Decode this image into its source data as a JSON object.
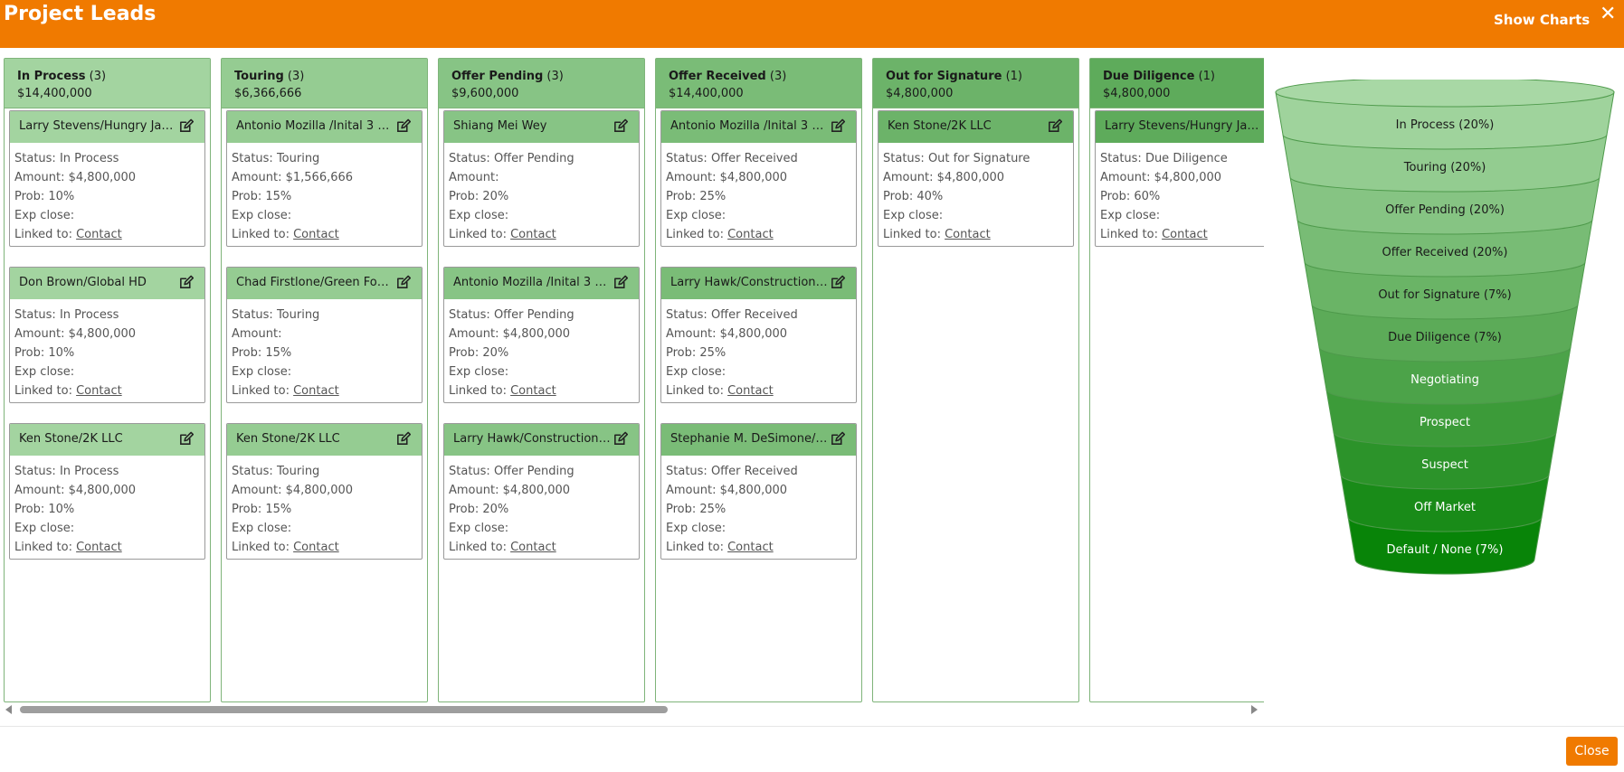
{
  "header": {
    "title": "Project Leads",
    "show_charts": "Show Charts",
    "close_glyph": "✕"
  },
  "labels": {
    "status": "Status: ",
    "amount": "Amount: ",
    "prob": "Prob: ",
    "exp_close": "Exp close: ",
    "linked_to": "Linked to: "
  },
  "colors": {
    "accent": "#f07a00"
  },
  "columns": [
    {
      "name": "In Process",
      "count": "(3)",
      "total": "$14,400,000",
      "head_color": "#a3d4a0",
      "cards": [
        {
          "title": "Larry Stevens/Hungry Jacks",
          "status": "In Process",
          "amount": "$4,800,000",
          "prob": "10%",
          "exp_close": "",
          "linked": "Contact"
        },
        {
          "title": "Don Brown/Global HD",
          "status": "In Process",
          "amount": "$4,800,000",
          "prob": "10%",
          "exp_close": "",
          "linked": "Contact"
        },
        {
          "title": "Ken Stone/2K LLC",
          "status": "In Process",
          "amount": "$4,800,000",
          "prob": "10%",
          "exp_close": "",
          "linked": "Contact"
        }
      ]
    },
    {
      "name": "Touring",
      "count": "(3)",
      "total": "$6,366,666",
      "head_color": "#95cc92",
      "cards": [
        {
          "title": "Antonio Mozilla /Inital 3 D...",
          "status": "Touring",
          "amount": "$1,566,666",
          "prob": "15%",
          "exp_close": "",
          "linked": "Contact"
        },
        {
          "title": "Chad Firstlone/Green Foo...",
          "status": "Touring",
          "amount": "",
          "prob": "15%",
          "exp_close": "",
          "linked": "Contact"
        },
        {
          "title": "Ken Stone/2K LLC",
          "status": "Touring",
          "amount": "$4,800,000",
          "prob": "15%",
          "exp_close": "",
          "linked": "Contact"
        }
      ]
    },
    {
      "name": "Offer Pending",
      "count": "(3)",
      "total": "$9,600,000",
      "head_color": "#87c485",
      "cards": [
        {
          "title": "Shiang Mei Wey",
          "status": "Offer Pending",
          "amount": "",
          "prob": "20%",
          "exp_close": "",
          "linked": "Contact"
        },
        {
          "title": "Antonio Mozilla /Inital 3 D...",
          "status": "Offer Pending",
          "amount": "$4,800,000",
          "prob": "20%",
          "exp_close": "",
          "linked": "Contact"
        },
        {
          "title": "Larry Hawk/Construction ...",
          "status": "Offer Pending",
          "amount": "$4,800,000",
          "prob": "20%",
          "exp_close": "",
          "linked": "Contact"
        }
      ]
    },
    {
      "name": "Offer Received",
      "count": "(3)",
      "total": "$14,400,000",
      "head_color": "#7abc77",
      "cards": [
        {
          "title": "Antonio Mozilla /Inital 3 D...",
          "status": "Offer Received",
          "amount": "$4,800,000",
          "prob": "25%",
          "exp_close": "",
          "linked": "Contact"
        },
        {
          "title": "Larry Hawk/Construction ...",
          "status": "Offer Received",
          "amount": "$4,800,000",
          "prob": "25%",
          "exp_close": "",
          "linked": "Contact"
        },
        {
          "title": "Stephanie M. DeSimone/C...",
          "status": "Offer Received",
          "amount": "$4,800,000",
          "prob": "25%",
          "exp_close": "",
          "linked": "Contact"
        }
      ]
    },
    {
      "name": "Out for Signature",
      "count": "(1)",
      "total": "$4,800,000",
      "head_color": "#6cb369",
      "cards": [
        {
          "title": "Ken Stone/2K LLC",
          "status": "Out for Signature",
          "amount": "$4,800,000",
          "prob": "40%",
          "exp_close": "",
          "linked": "Contact"
        }
      ]
    },
    {
      "name": "Due Diligence",
      "count": "(1)",
      "total": "$4,800,000",
      "head_color": "#5eab5b",
      "cards": [
        {
          "title": "Larry Stevens/Hungry Jacks",
          "status": "Due Diligence",
          "amount": "$4,800,000",
          "prob": "60%",
          "exp_close": "",
          "linked": "Contact"
        }
      ]
    }
  ],
  "funnel": [
    {
      "label": "In Process (20%)",
      "color": "#9fd39c"
    },
    {
      "label": "Touring (20%)",
      "color": "#93cc90"
    },
    {
      "label": "Offer Pending (20%)",
      "color": "#86c483"
    },
    {
      "label": "Offer Received (20%)",
      "color": "#78bc75"
    },
    {
      "label": "Out for Signature (7%)",
      "color": "#6ab466"
    },
    {
      "label": "Due Diligence (7%)",
      "color": "#5cab58"
    },
    {
      "label": "Negotiating",
      "color": "#4ca349"
    },
    {
      "label": "Prospect",
      "color": "#3c9b39"
    },
    {
      "label": "Suspect",
      "color": "#2c932a"
    },
    {
      "label": "Off Market",
      "color": "#198b18"
    },
    {
      "label": "Default / None (7%)",
      "color": "#088408"
    }
  ],
  "footer": {
    "close_label": "Close"
  }
}
